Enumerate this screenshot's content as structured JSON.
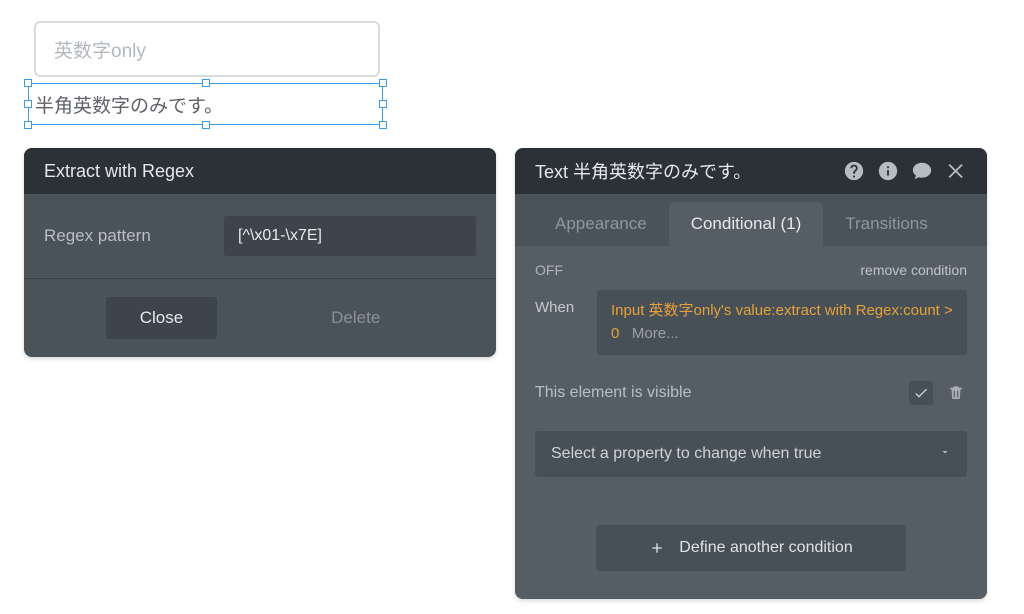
{
  "canvas": {
    "input_placeholder": "英数字only",
    "selected_text": "半角英数字のみです。"
  },
  "left_panel": {
    "title": "Extract with Regex",
    "regex_label": "Regex pattern",
    "regex_value": "[^\\x01-\\x7E]",
    "close_label": "Close",
    "delete_label": "Delete"
  },
  "right_panel": {
    "title": "Text 半角英数字のみです。",
    "tabs": {
      "appearance": "Appearance",
      "conditional": "Conditional (1)",
      "transitions": "Transitions"
    },
    "conditional": {
      "off": "OFF",
      "remove": "remove condition",
      "when_label": "When",
      "expr_hl": "Input 英数字only's value:extract with Regex:count > 0",
      "expr_more": "More...",
      "visible_label": "This element is visible",
      "select_prop": "Select a property to change when true",
      "define_label": "Define another condition"
    }
  }
}
